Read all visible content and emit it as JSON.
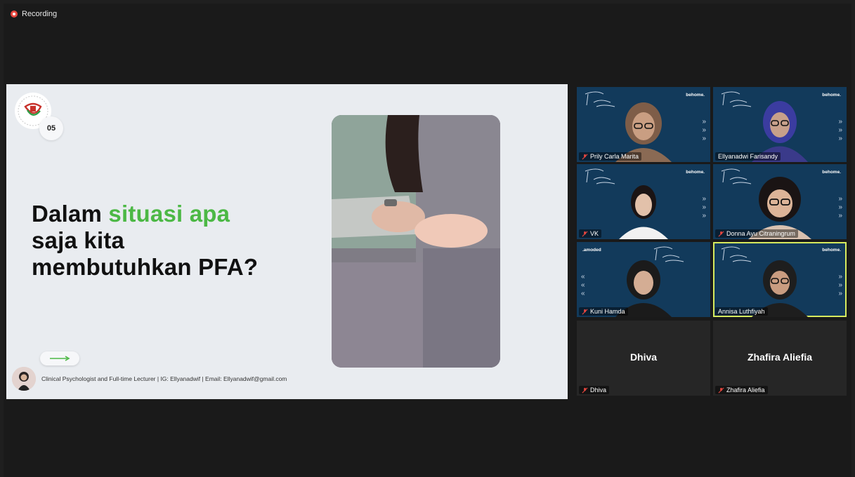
{
  "recording": {
    "label": "Recording"
  },
  "slide": {
    "number": "05",
    "headline_part1": "Dalam ",
    "headline_green": "situasi apa",
    "headline_part2": "saja kita",
    "headline_part3": "membutuhkan PFA?",
    "footer": "Clinical Psychologist and Full-time Lecturer | IG: Ellyanadwif | Email: Ellyanadwif@gmail.com",
    "accent_color": "#4cb845"
  },
  "gallery": {
    "tiles": [
      {
        "name": "Prily Carla Marita",
        "brand": "behome."
      },
      {
        "name": "Ellyanadwi Farisandy",
        "brand": "behome."
      },
      {
        "name": "VK",
        "brand": "behome."
      },
      {
        "name": "Donna Ayu Citraningrum",
        "brand": "behome."
      },
      {
        "name": "Kuni Hamda",
        "brand": ".amoded"
      },
      {
        "name": "Annisa Luthfiyah",
        "brand": "behome."
      },
      {
        "name": "Dhiva",
        "display": "Dhiva"
      },
      {
        "name": "Zhafira Aliefia",
        "display": "Zhafira Aliefia"
      }
    ]
  }
}
